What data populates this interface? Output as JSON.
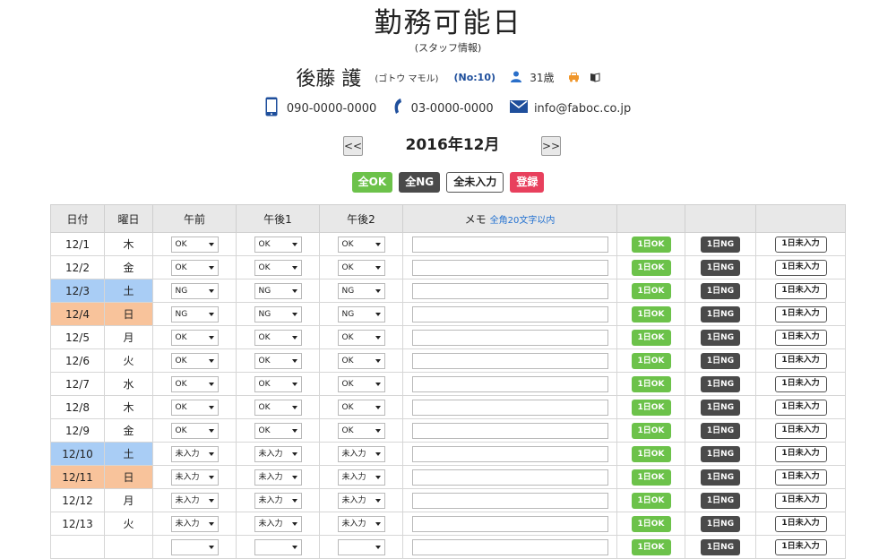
{
  "header": {
    "title": "勤務可能日",
    "subtitle": "(スタッフ情報)"
  },
  "staff": {
    "name": "後藤 護",
    "kana": "(ゴトウ マモル)",
    "number": "(No:10)",
    "age": "31歳"
  },
  "contact": {
    "mobile": "090-0000-0000",
    "phone": "03-0000-0000",
    "email": "info@faboc.co.jp"
  },
  "month": {
    "prev_label": "<<",
    "label": "2016年12月",
    "next_label": ">>"
  },
  "bulk_actions": {
    "all_ok": "全OK",
    "all_ng": "全NG",
    "all_unset": "全未入力",
    "register": "登録"
  },
  "table": {
    "headers": {
      "date": "日付",
      "weekday": "曜日",
      "am": "午前",
      "pm1": "午後1",
      "pm2": "午後2",
      "memo": "メモ",
      "memo_note": "全角20文字以内"
    },
    "row_buttons": {
      "ok": "1日OK",
      "ng": "1日NG",
      "unset": "1日未入力"
    },
    "rows": [
      {
        "date": "12/1",
        "weekday": "木",
        "type": "weekday",
        "am": "OK",
        "pm1": "OK",
        "pm2": "OK"
      },
      {
        "date": "12/2",
        "weekday": "金",
        "type": "weekday",
        "am": "OK",
        "pm1": "OK",
        "pm2": "OK"
      },
      {
        "date": "12/3",
        "weekday": "土",
        "type": "sat",
        "am": "NG",
        "pm1": "NG",
        "pm2": "NG"
      },
      {
        "date": "12/4",
        "weekday": "日",
        "type": "sun",
        "am": "NG",
        "pm1": "NG",
        "pm2": "NG"
      },
      {
        "date": "12/5",
        "weekday": "月",
        "type": "weekday",
        "am": "OK",
        "pm1": "OK",
        "pm2": "OK"
      },
      {
        "date": "12/6",
        "weekday": "火",
        "type": "weekday",
        "am": "OK",
        "pm1": "OK",
        "pm2": "OK"
      },
      {
        "date": "12/7",
        "weekday": "水",
        "type": "weekday",
        "am": "OK",
        "pm1": "OK",
        "pm2": "OK"
      },
      {
        "date": "12/8",
        "weekday": "木",
        "type": "weekday",
        "am": "OK",
        "pm1": "OK",
        "pm2": "OK"
      },
      {
        "date": "12/9",
        "weekday": "金",
        "type": "weekday",
        "am": "OK",
        "pm1": "OK",
        "pm2": "OK"
      },
      {
        "date": "12/10",
        "weekday": "土",
        "type": "sat",
        "am": "未入力",
        "pm1": "未入力",
        "pm2": "未入力"
      },
      {
        "date": "12/11",
        "weekday": "日",
        "type": "sun",
        "am": "未入力",
        "pm1": "未入力",
        "pm2": "未入力"
      },
      {
        "date": "12/12",
        "weekday": "月",
        "type": "weekday",
        "am": "未入力",
        "pm1": "未入力",
        "pm2": "未入力"
      },
      {
        "date": "12/13",
        "weekday": "火",
        "type": "weekday",
        "am": "未入力",
        "pm1": "未入力",
        "pm2": "未入力"
      },
      {
        "date": "",
        "weekday": "",
        "type": "weekday",
        "am": "",
        "pm1": "",
        "pm2": ""
      }
    ]
  },
  "colors": {
    "ok_green": "#6cc24a",
    "ng_dark": "#4a4a4a",
    "register_red": "#e8405d",
    "saturday_blue": "#a9cdf5",
    "sunday_orange": "#f8c39b",
    "accent_blue": "#1f4f9c"
  },
  "icons": {
    "person": "person-icon",
    "car": "car-icon",
    "book": "book-icon",
    "mobile": "mobile-phone-icon",
    "phone": "phone-icon",
    "mail": "mail-icon"
  }
}
